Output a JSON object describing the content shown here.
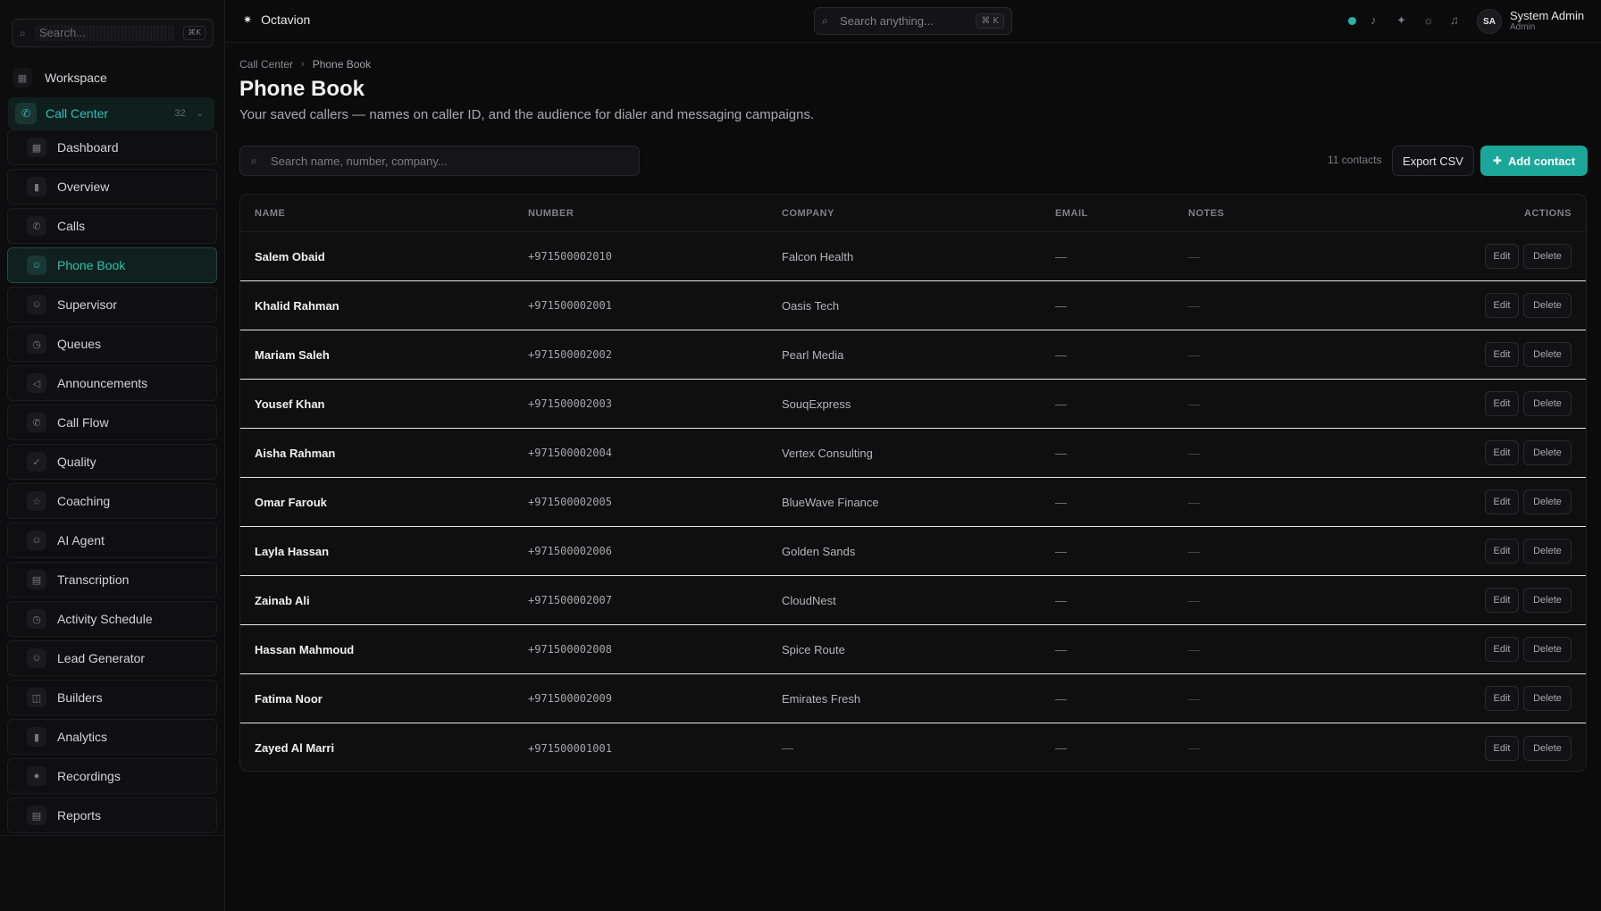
{
  "sidebar": {
    "search_placeholder": "Search...",
    "search_shortcut": "⌘K",
    "workspace_label": "Workspace",
    "section": {
      "label": "Call Center",
      "count": "32"
    },
    "items": [
      {
        "label": "Dashboard",
        "icon": "dashboard-icon",
        "glyph": "▦"
      },
      {
        "label": "Overview",
        "icon": "bar-chart-icon",
        "glyph": "▮"
      },
      {
        "label": "Calls",
        "icon": "phone-icon",
        "glyph": "✆"
      },
      {
        "label": "Phone Book",
        "icon": "contacts-icon",
        "glyph": "☺"
      },
      {
        "label": "Supervisor",
        "icon": "user-icon",
        "glyph": "☺"
      },
      {
        "label": "Queues",
        "icon": "clock-icon",
        "glyph": "◷"
      },
      {
        "label": "Announcements",
        "icon": "megaphone-icon",
        "glyph": "◁"
      },
      {
        "label": "Call Flow",
        "icon": "phone-flow-icon",
        "glyph": "✆"
      },
      {
        "label": "Quality",
        "icon": "check-icon",
        "glyph": "✓"
      },
      {
        "label": "Coaching",
        "icon": "star-icon",
        "glyph": "☆"
      },
      {
        "label": "AI Agent",
        "icon": "robot-icon",
        "glyph": "☺"
      },
      {
        "label": "Transcription",
        "icon": "document-icon",
        "glyph": "▤"
      },
      {
        "label": "Activity Schedule",
        "icon": "clock-icon",
        "glyph": "◷"
      },
      {
        "label": "Lead Generator",
        "icon": "user-plus-icon",
        "glyph": "☺"
      },
      {
        "label": "Builders",
        "icon": "layout-icon",
        "glyph": "◫"
      },
      {
        "label": "Analytics",
        "icon": "bar-chart-icon",
        "glyph": "▮"
      },
      {
        "label": "Recordings",
        "icon": "mic-icon",
        "glyph": "●"
      },
      {
        "label": "Reports",
        "icon": "report-icon",
        "glyph": "▤"
      }
    ],
    "active_index": 3
  },
  "topbar": {
    "brand": "Octavion",
    "search_placeholder": "Search anything...",
    "search_shortcut": "⌘ K",
    "user_initials": "SA",
    "user_name": "System Admin",
    "user_role": "Admin"
  },
  "page": {
    "breadcrumb_parent": "Call Center",
    "breadcrumb_current": "Phone Book",
    "title": "Phone Book",
    "subtitle": "Your saved callers — names on caller ID, and the audience for dialer and messaging campaigns.",
    "search_placeholder": "Search name, number, company...",
    "contact_count": "11 contacts",
    "export_label": "Export CSV",
    "add_label": "Add contact"
  },
  "table": {
    "headers": {
      "name": "NAME",
      "number": "NUMBER",
      "company": "COMPANY",
      "email": "EMAIL",
      "notes": "NOTES",
      "actions": "ACTIONS"
    },
    "edit_label": "Edit",
    "delete_label": "Delete",
    "rows": [
      {
        "name": "Salem Obaid",
        "number": "+971500002010",
        "company": "Falcon Health",
        "email": "—",
        "notes": "—"
      },
      {
        "name": "Khalid Rahman",
        "number": "+971500002001",
        "company": "Oasis Tech",
        "email": "—",
        "notes": "—"
      },
      {
        "name": "Mariam Saleh",
        "number": "+971500002002",
        "company": "Pearl Media",
        "email": "—",
        "notes": "—"
      },
      {
        "name": "Yousef Khan",
        "number": "+971500002003",
        "company": "SouqExpress",
        "email": "—",
        "notes": "—"
      },
      {
        "name": "Aisha Rahman",
        "number": "+971500002004",
        "company": "Vertex Consulting",
        "email": "—",
        "notes": "—"
      },
      {
        "name": "Omar Farouk",
        "number": "+971500002005",
        "company": "BlueWave Finance",
        "email": "—",
        "notes": "—"
      },
      {
        "name": "Layla Hassan",
        "number": "+971500002006",
        "company": "Golden Sands",
        "email": "—",
        "notes": "—"
      },
      {
        "name": "Zainab Ali",
        "number": "+971500002007",
        "company": "CloudNest",
        "email": "—",
        "notes": "—"
      },
      {
        "name": "Hassan Mahmoud",
        "number": "+971500002008",
        "company": "Spice Route",
        "email": "—",
        "notes": "—"
      },
      {
        "name": "Fatima Noor",
        "number": "+971500002009",
        "company": "Emirates Fresh",
        "email": "—",
        "notes": "—"
      },
      {
        "name": "Zayed Al Marri",
        "number": "+971500001001",
        "company": "—",
        "email": "—",
        "notes": "—"
      }
    ]
  },
  "colors": {
    "accent": "#1aa79a",
    "accent_text": "#2cc1b2",
    "background": "#0b0b0c"
  }
}
